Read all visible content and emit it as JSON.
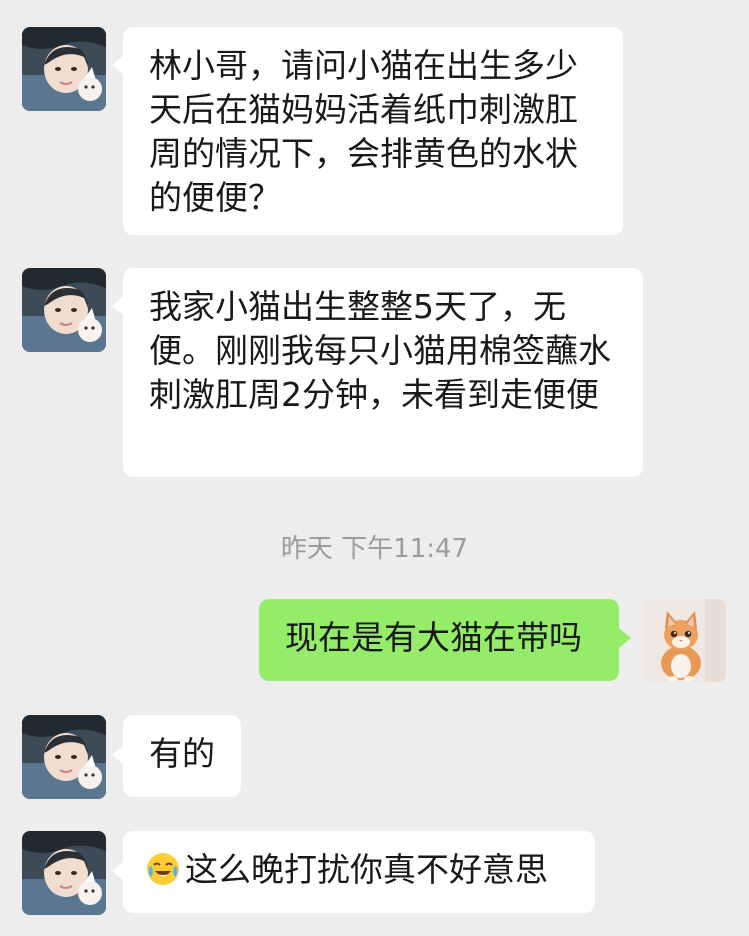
{
  "messages": [
    {
      "side": "in",
      "sender": "contact",
      "avatar_icon": "person-with-cat-avatar-icon",
      "text": "林小哥，请问小猫在出生多少天后在猫妈妈活着纸巾刺激肛周的情况下，会排黄色的水状的便便？"
    },
    {
      "side": "in",
      "sender": "contact",
      "avatar_icon": "person-with-cat-avatar-icon",
      "text": "我家小猫出生整整5天了，无便。刚刚我每只小猫用棉签蘸水刺激肛周2分钟，未看到走便便"
    },
    {
      "side": "out",
      "sender": "self",
      "avatar_icon": "orange-kitten-avatar-icon",
      "text": "现在是有大猫在带吗"
    },
    {
      "side": "in",
      "sender": "contact",
      "avatar_icon": "person-with-cat-avatar-icon",
      "text": "有的"
    },
    {
      "side": "in",
      "sender": "contact",
      "avatar_icon": "person-with-cat-avatar-icon",
      "emoji": "crying-laughing-face-icon",
      "text": "这么晚打扰你真不好意思"
    }
  ],
  "timestamp": "昨天 下午11:47",
  "colors": {
    "background": "#ededed",
    "incoming_bubble": "#ffffff",
    "outgoing_bubble": "#95ec69",
    "timestamp_text": "#9b9b9b",
    "message_text": "#191919"
  }
}
